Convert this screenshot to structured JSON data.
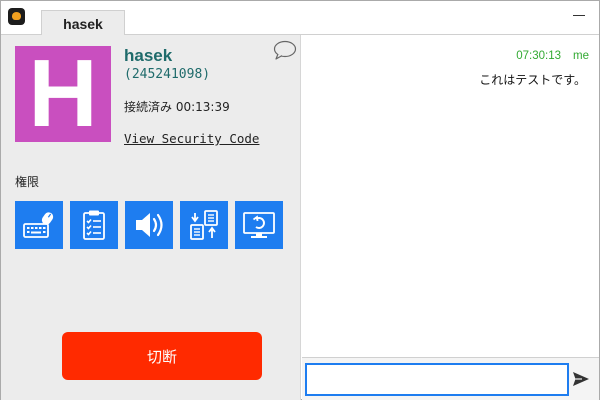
{
  "tab": {
    "title": "hasek"
  },
  "user": {
    "avatar_letter": "H",
    "avatar_color": "#c94fbf",
    "name": "hasek",
    "id": "(245241098)",
    "status": "接続済み 00:13:39",
    "security_link": "View Security Code"
  },
  "permissions": {
    "label": "権限",
    "buttons": [
      {
        "icon": "keyboard-mouse-icon"
      },
      {
        "icon": "clipboard-icon"
      },
      {
        "icon": "speaker-icon"
      },
      {
        "icon": "file-transfer-icon"
      },
      {
        "icon": "restart-icon"
      }
    ],
    "accent_color": "#1e7df0"
  },
  "actions": {
    "disconnect_label": "切断",
    "disconnect_color": "#ff2a00"
  },
  "chat": {
    "messages": [
      {
        "time": "07:30:13",
        "sender": "me",
        "text": "これはテストです。"
      }
    ],
    "input_value": "",
    "input_placeholder": ""
  }
}
